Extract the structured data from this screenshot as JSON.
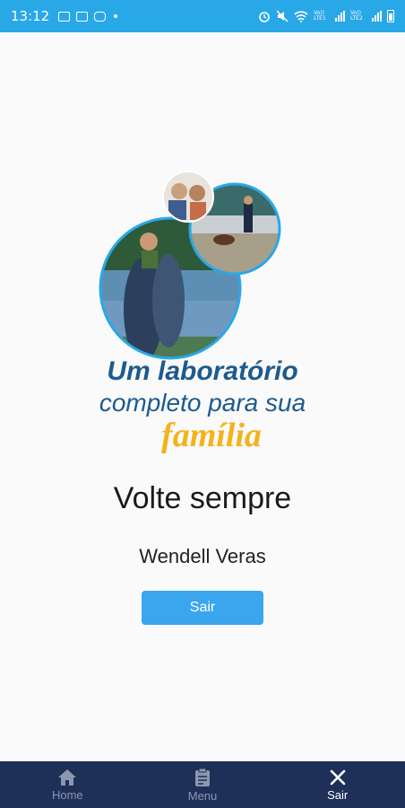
{
  "status_bar": {
    "time": "13:12",
    "icons_left": [
      "image-icon",
      "hd-icon",
      "instagram-icon",
      "dot-icon"
    ],
    "icons_right": [
      "alarm-icon",
      "mute-icon",
      "wifi-icon",
      "signal-icon",
      "signal-icon",
      "battery-icon"
    ],
    "volte1": "Vo)) LTE1",
    "volte2": "Vo)) LTE2"
  },
  "logo": {
    "line1": "Um laboratório",
    "line2": "completo para sua",
    "line3": "família"
  },
  "main": {
    "title": "Volte sempre",
    "username": "Wendell Veras",
    "button_label": "Sair"
  },
  "bottom_nav": {
    "items": [
      {
        "label": "Home",
        "icon": "home-icon",
        "active": false
      },
      {
        "label": "Menu",
        "icon": "clipboard-icon",
        "active": false
      },
      {
        "label": "Sair",
        "icon": "close-icon",
        "active": true
      }
    ]
  },
  "colors": {
    "status_bar": "#29a8e8",
    "button": "#3aa6ee",
    "nav_bg": "#1e2f58",
    "logo_blue": "#1d5a8e",
    "logo_yellow": "#f4b21b"
  }
}
